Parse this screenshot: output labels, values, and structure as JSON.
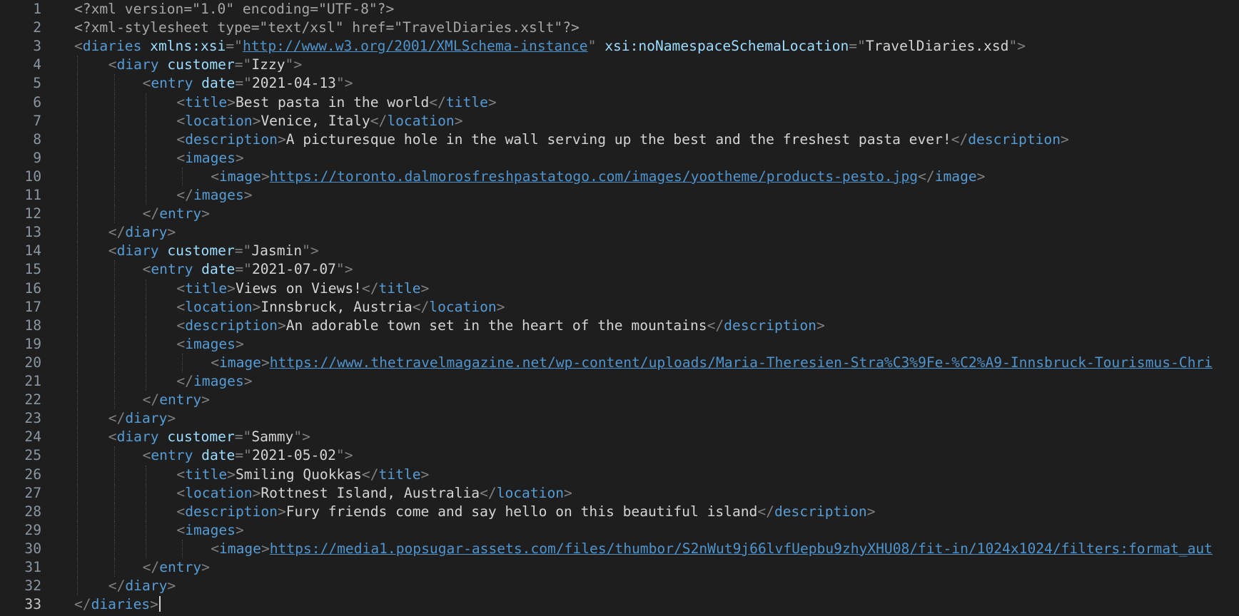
{
  "editor": {
    "lines": [
      {
        "num": "1",
        "indent": 0,
        "segs": [
          [
            "pi",
            "<?xml version=\"1.0\" encoding=\"UTF-8\"?>"
          ]
        ]
      },
      {
        "num": "2",
        "indent": 0,
        "segs": [
          [
            "pi",
            "<?xml-stylesheet type=\"text/xsl\" href=\"TravelDiaries.xslt\"?>"
          ]
        ]
      },
      {
        "num": "3",
        "indent": 0,
        "segs": [
          [
            "p",
            "<"
          ],
          [
            "t",
            "diaries"
          ],
          [
            "x",
            " "
          ],
          [
            "a",
            "xmlns:xsi"
          ],
          [
            "p",
            "=\""
          ],
          [
            "u",
            "http://www.w3.org/2001/XMLSchema-instance"
          ],
          [
            "p",
            "\""
          ],
          [
            "x",
            " "
          ],
          [
            "a",
            "xsi:noNamespaceSchemaLocation"
          ],
          [
            "p",
            "=\""
          ],
          [
            "sv",
            "TravelDiaries.xsd"
          ],
          [
            "p",
            "\">"
          ]
        ]
      },
      {
        "num": "4",
        "indent": 1,
        "segs": [
          [
            "p",
            "<"
          ],
          [
            "t",
            "diary"
          ],
          [
            "x",
            " "
          ],
          [
            "a",
            "customer"
          ],
          [
            "p",
            "=\""
          ],
          [
            "sv",
            "Izzy"
          ],
          [
            "p",
            "\">"
          ]
        ]
      },
      {
        "num": "5",
        "indent": 2,
        "segs": [
          [
            "p",
            "<"
          ],
          [
            "t",
            "entry"
          ],
          [
            "x",
            " "
          ],
          [
            "a",
            "date"
          ],
          [
            "p",
            "=\""
          ],
          [
            "sv",
            "2021-04-13"
          ],
          [
            "p",
            "\">"
          ]
        ]
      },
      {
        "num": "6",
        "indent": 3,
        "segs": [
          [
            "p",
            "<"
          ],
          [
            "t",
            "title"
          ],
          [
            "p",
            ">"
          ],
          [
            "x",
            "Best pasta in the world"
          ],
          [
            "p",
            "</"
          ],
          [
            "t",
            "title"
          ],
          [
            "p",
            ">"
          ]
        ]
      },
      {
        "num": "7",
        "indent": 3,
        "segs": [
          [
            "p",
            "<"
          ],
          [
            "t",
            "location"
          ],
          [
            "p",
            ">"
          ],
          [
            "x",
            "Venice, Italy"
          ],
          [
            "p",
            "</"
          ],
          [
            "t",
            "location"
          ],
          [
            "p",
            ">"
          ]
        ]
      },
      {
        "num": "8",
        "indent": 3,
        "segs": [
          [
            "p",
            "<"
          ],
          [
            "t",
            "description"
          ],
          [
            "p",
            ">"
          ],
          [
            "x",
            "A picturesque hole in the wall serving up the best and the freshest pasta ever!"
          ],
          [
            "p",
            "</"
          ],
          [
            "t",
            "description"
          ],
          [
            "p",
            ">"
          ]
        ]
      },
      {
        "num": "9",
        "indent": 3,
        "segs": [
          [
            "p",
            "<"
          ],
          [
            "t",
            "images"
          ],
          [
            "p",
            ">"
          ]
        ]
      },
      {
        "num": "10",
        "indent": 4,
        "segs": [
          [
            "p",
            "<"
          ],
          [
            "t",
            "image"
          ],
          [
            "p",
            ">"
          ],
          [
            "u",
            "https://toronto.dalmorosfreshpastatogo.com/images/yootheme/products-pesto.jpg"
          ],
          [
            "p",
            "</"
          ],
          [
            "t",
            "image"
          ],
          [
            "p",
            ">"
          ]
        ]
      },
      {
        "num": "11",
        "indent": 3,
        "segs": [
          [
            "p",
            "</"
          ],
          [
            "t",
            "images"
          ],
          [
            "p",
            ">"
          ]
        ]
      },
      {
        "num": "12",
        "indent": 2,
        "segs": [
          [
            "p",
            "</"
          ],
          [
            "t",
            "entry"
          ],
          [
            "p",
            ">"
          ]
        ]
      },
      {
        "num": "13",
        "indent": 1,
        "segs": [
          [
            "p",
            "</"
          ],
          [
            "t",
            "diary"
          ],
          [
            "p",
            ">"
          ]
        ]
      },
      {
        "num": "14",
        "indent": 1,
        "segs": [
          [
            "p",
            "<"
          ],
          [
            "t",
            "diary"
          ],
          [
            "x",
            " "
          ],
          [
            "a",
            "customer"
          ],
          [
            "p",
            "=\""
          ],
          [
            "sv",
            "Jasmin"
          ],
          [
            "p",
            "\">"
          ]
        ]
      },
      {
        "num": "15",
        "indent": 2,
        "segs": [
          [
            "p",
            "<"
          ],
          [
            "t",
            "entry"
          ],
          [
            "x",
            " "
          ],
          [
            "a",
            "date"
          ],
          [
            "p",
            "=\""
          ],
          [
            "sv",
            "2021-07-07"
          ],
          [
            "p",
            "\">"
          ]
        ]
      },
      {
        "num": "16",
        "indent": 3,
        "segs": [
          [
            "p",
            "<"
          ],
          [
            "t",
            "title"
          ],
          [
            "p",
            ">"
          ],
          [
            "x",
            "Views on Views!"
          ],
          [
            "p",
            "</"
          ],
          [
            "t",
            "title"
          ],
          [
            "p",
            ">"
          ]
        ]
      },
      {
        "num": "17",
        "indent": 3,
        "segs": [
          [
            "p",
            "<"
          ],
          [
            "t",
            "location"
          ],
          [
            "p",
            ">"
          ],
          [
            "x",
            "Innsbruck, Austria"
          ],
          [
            "p",
            "</"
          ],
          [
            "t",
            "location"
          ],
          [
            "p",
            ">"
          ]
        ]
      },
      {
        "num": "18",
        "indent": 3,
        "segs": [
          [
            "p",
            "<"
          ],
          [
            "t",
            "description"
          ],
          [
            "p",
            ">"
          ],
          [
            "x",
            "An adorable town set in the heart of the mountains"
          ],
          [
            "p",
            "</"
          ],
          [
            "t",
            "description"
          ],
          [
            "p",
            ">"
          ]
        ]
      },
      {
        "num": "19",
        "indent": 3,
        "segs": [
          [
            "p",
            "<"
          ],
          [
            "t",
            "images"
          ],
          [
            "p",
            ">"
          ]
        ]
      },
      {
        "num": "20",
        "indent": 4,
        "segs": [
          [
            "p",
            "<"
          ],
          [
            "t",
            "image"
          ],
          [
            "p",
            ">"
          ],
          [
            "u",
            "https://www.thetravelmagazine.net/wp-content/uploads/Maria-Theresien-Stra%C3%9Fe-%C2%A9-Innsbruck-Tourismus-Chri"
          ]
        ]
      },
      {
        "num": "21",
        "indent": 3,
        "segs": [
          [
            "p",
            "</"
          ],
          [
            "t",
            "images"
          ],
          [
            "p",
            ">"
          ]
        ]
      },
      {
        "num": "22",
        "indent": 2,
        "segs": [
          [
            "p",
            "</"
          ],
          [
            "t",
            "entry"
          ],
          [
            "p",
            ">"
          ]
        ]
      },
      {
        "num": "23",
        "indent": 1,
        "segs": [
          [
            "p",
            "</"
          ],
          [
            "t",
            "diary"
          ],
          [
            "p",
            ">"
          ]
        ]
      },
      {
        "num": "24",
        "indent": 1,
        "segs": [
          [
            "p",
            "<"
          ],
          [
            "t",
            "diary"
          ],
          [
            "x",
            " "
          ],
          [
            "a",
            "customer"
          ],
          [
            "p",
            "=\""
          ],
          [
            "sv",
            "Sammy"
          ],
          [
            "p",
            "\">"
          ]
        ]
      },
      {
        "num": "25",
        "indent": 2,
        "segs": [
          [
            "p",
            "<"
          ],
          [
            "t",
            "entry"
          ],
          [
            "x",
            " "
          ],
          [
            "a",
            "date"
          ],
          [
            "p",
            "=\""
          ],
          [
            "sv",
            "2021-05-02"
          ],
          [
            "p",
            "\">"
          ]
        ]
      },
      {
        "num": "26",
        "indent": 3,
        "segs": [
          [
            "p",
            "<"
          ],
          [
            "t",
            "title"
          ],
          [
            "p",
            ">"
          ],
          [
            "x",
            "Smiling Quokkas"
          ],
          [
            "p",
            "</"
          ],
          [
            "t",
            "title"
          ],
          [
            "p",
            ">"
          ]
        ]
      },
      {
        "num": "27",
        "indent": 3,
        "segs": [
          [
            "p",
            "<"
          ],
          [
            "t",
            "location"
          ],
          [
            "p",
            ">"
          ],
          [
            "x",
            "Rottnest Island, Australia"
          ],
          [
            "p",
            "</"
          ],
          [
            "t",
            "location"
          ],
          [
            "p",
            ">"
          ]
        ]
      },
      {
        "num": "28",
        "indent": 3,
        "segs": [
          [
            "p",
            "<"
          ],
          [
            "t",
            "description"
          ],
          [
            "p",
            ">"
          ],
          [
            "x",
            "Fury friends come and say hello on this beautiful island"
          ],
          [
            "p",
            "</"
          ],
          [
            "t",
            "description"
          ],
          [
            "p",
            ">"
          ]
        ]
      },
      {
        "num": "29",
        "indent": 3,
        "segs": [
          [
            "p",
            "<"
          ],
          [
            "t",
            "images"
          ],
          [
            "p",
            ">"
          ]
        ]
      },
      {
        "num": "30",
        "indent": 4,
        "segs": [
          [
            "p",
            "<"
          ],
          [
            "t",
            "image"
          ],
          [
            "p",
            ">"
          ],
          [
            "u",
            "https://media1.popsugar-assets.com/files/thumbor/S2nWut9j66lvfUepbu9zhyXHU08/fit-in/1024x1024/filters:format_aut"
          ]
        ]
      },
      {
        "num": "31",
        "indent": 2,
        "segs": [
          [
            "p",
            "</"
          ],
          [
            "t",
            "entry"
          ],
          [
            "p",
            ">"
          ]
        ]
      },
      {
        "num": "32",
        "indent": 1,
        "segs": [
          [
            "p",
            "</"
          ],
          [
            "t",
            "diary"
          ],
          [
            "p",
            ">"
          ]
        ]
      },
      {
        "num": "33",
        "indent": 0,
        "active": true,
        "segs": [
          [
            "p",
            "</"
          ],
          [
            "t",
            "diaries"
          ],
          [
            "p",
            ">"
          ]
        ]
      }
    ]
  },
  "colors": {
    "background": "#1e1e1e",
    "tag": "#569cd6",
    "attribute": "#9cdcfe",
    "punctuation": "#808080",
    "text": "#d4d4d4",
    "link": "#4e94ce",
    "line_number": "#8b96a3"
  }
}
